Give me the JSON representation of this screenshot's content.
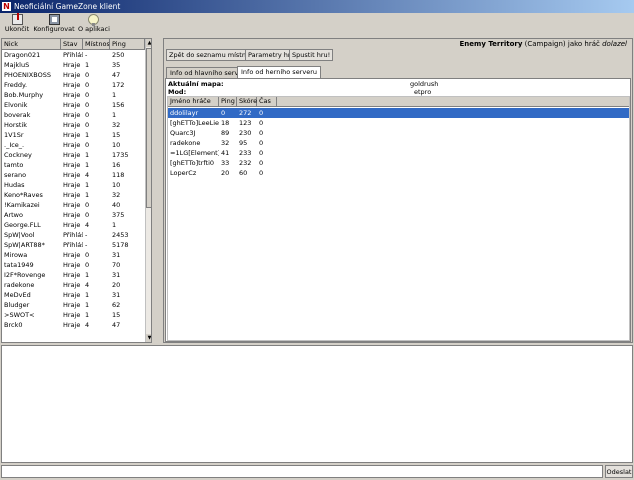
{
  "window": {
    "title": "Neoficiální GameZone klient"
  },
  "toolbar": {
    "exit_label": "Ukončit",
    "config_label": "Konfigurovat",
    "about_label": "O aplikaci"
  },
  "players_list": {
    "headers": [
      "Nick",
      "Stav",
      "Místnost",
      "Ping"
    ],
    "rows": [
      [
        "Dragon021",
        "Přihláš",
        "-",
        "250"
      ],
      [
        "MajkluS",
        "Hraje",
        "1",
        "35"
      ],
      [
        "PHOENIXBOSS",
        "Hraje",
        "0",
        "47"
      ],
      [
        "Freddy.",
        "Hraje",
        "0",
        "172"
      ],
      [
        "Bob.Murphy",
        "Hraje",
        "0",
        "1"
      ],
      [
        "Elvonik",
        "Hraje",
        "0",
        "156"
      ],
      [
        "boverak",
        "Hraje",
        "0",
        "1"
      ],
      [
        "Horstik",
        "Hraje",
        "0",
        "32"
      ],
      [
        "1V1Sr",
        "Hraje",
        "1",
        "15"
      ],
      [
        "._Ice_.",
        "Hraje",
        "0",
        "10"
      ],
      [
        "Cockney",
        "Hraje",
        "1",
        "1735"
      ],
      [
        "tamto",
        "Hraje",
        "1",
        "16"
      ],
      [
        "serano",
        "Hraje",
        "4",
        "118"
      ],
      [
        "Hudas",
        "Hraje",
        "1",
        "10"
      ],
      [
        "Keno*Raves",
        "Hraje",
        "1",
        "32"
      ],
      [
        "!Kamikazei",
        "Hraje",
        "0",
        "40"
      ],
      [
        "Artwo",
        "Hraje",
        "0",
        "375"
      ],
      [
        "George.FLL",
        "Hraje",
        "4",
        "1"
      ],
      [
        "SpW|Vool",
        "Přihláš",
        "-",
        "2453"
      ],
      [
        "SpW|ART88*",
        "Přihláš",
        "-",
        "5178"
      ],
      [
        "Mirowa",
        "Hraje",
        "0",
        "31"
      ],
      [
        "tata1949",
        "Hraje",
        "0",
        "70"
      ],
      [
        "I2F*Rovenge",
        "Hraje",
        "1",
        "31"
      ],
      [
        "radekone",
        "Hraje",
        "4",
        "20"
      ],
      [
        "MeDvEd",
        "Hraje",
        "1",
        "31"
      ],
      [
        "Bludger",
        "Hraje",
        "1",
        "62"
      ],
      [
        ">SWOT<",
        "Hraje",
        "1",
        "15"
      ],
      [
        "Brck0",
        "Hraje",
        "4",
        "47"
      ]
    ]
  },
  "server": {
    "game": "Enemy Territory",
    "mode": "(Campaign)",
    "suffix": "jako hráč",
    "status": "dolazel"
  },
  "actions": {
    "back_label": "Zpět do seznamu místností",
    "params_label": "Parametry hry",
    "start_label": "Spustit hru!"
  },
  "tabs": {
    "main_server": "Info od hlavního serveru",
    "game_server": "Info od herního serveru"
  },
  "server_info": {
    "map_label": "Aktuální mapa:",
    "map_value": "goldrush",
    "mod_label": "Mod:",
    "mod_value": "etpro"
  },
  "game_players": {
    "headers": [
      "Jméno hráče",
      "Ping",
      "Skóre",
      "Čas"
    ],
    "rows": [
      [
        "ddolilayr",
        "0",
        "272",
        "0"
      ],
      [
        "[ghETTo]LeeLie",
        "18",
        "123",
        "0"
      ],
      [
        "Quarc3J",
        "89",
        "230",
        "0"
      ],
      [
        "radekone",
        "32",
        "95",
        "0"
      ],
      [
        "=1LG[Element]iD",
        "41",
        "233",
        "0"
      ],
      [
        "[ghETTo]trfti0",
        "33",
        "232",
        "0"
      ],
      [
        "LoperCz",
        "20",
        "60",
        "0"
      ]
    ],
    "selected_index": 0
  },
  "chat": {
    "input_value": "",
    "send_label": "Odeslat"
  },
  "colors": {
    "selection": "#316ac5",
    "titlebar_start": "#0a246a",
    "titlebar_end": "#a6caf0",
    "panel": "#d4d0c8"
  },
  "icons": {
    "app": "app-icon",
    "exit": "exit-icon",
    "config": "config-icon",
    "about": "lightbulb-icon"
  }
}
